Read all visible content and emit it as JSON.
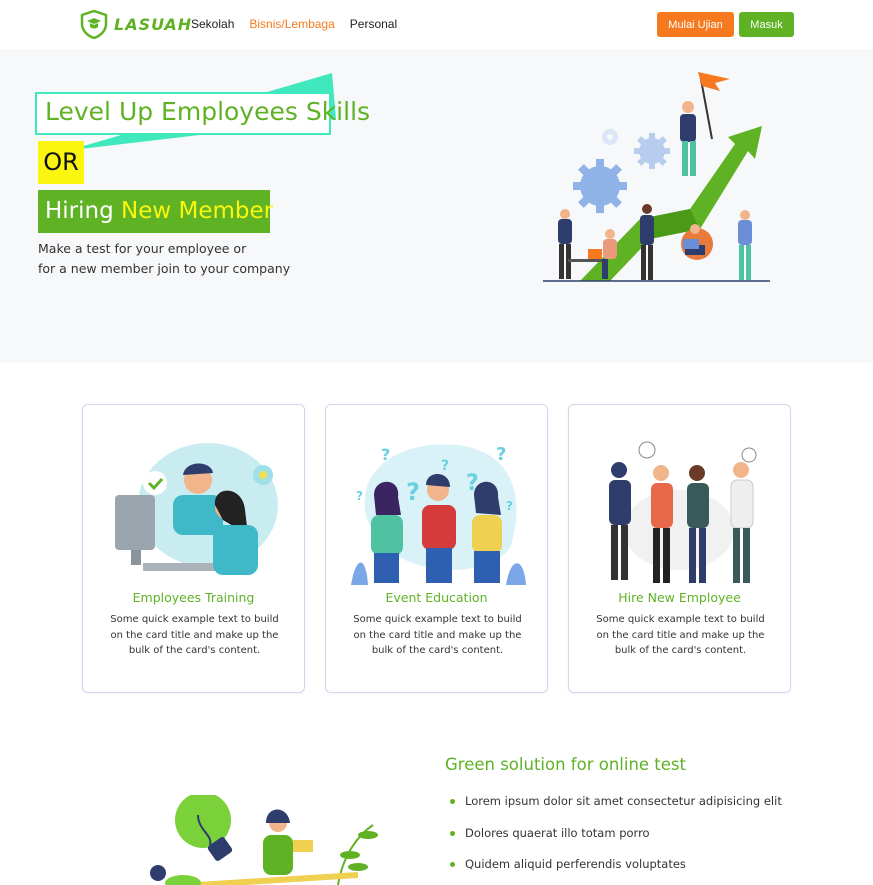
{
  "brand": {
    "name": "LASUAH",
    "color": "#5fb224"
  },
  "nav": {
    "links": [
      "Sekolah",
      "Bisnis/Lembaga",
      "Personal"
    ],
    "active_index": 1,
    "exam_button": "Mulai Ujian",
    "login_button": "Masuk"
  },
  "hero": {
    "title": "Level Up Employees Skills",
    "or_label": "OR",
    "hiring_prefix": "Hiring",
    "hiring_highlight": "New Member",
    "desc_line1": "Make a test for your employee or",
    "desc_line2": "for a new member join to your company"
  },
  "cards": [
    {
      "title": "Employees Training",
      "text": "Some quick example text to build on the card title and make up the bulk of the card's content."
    },
    {
      "title": "Event Education",
      "text": "Some quick example text to build on the card title and make up the bulk of the card's content."
    },
    {
      "title": "Hire New Employee",
      "text": "Some quick example text to build on the card title and make up the bulk of the card's content."
    }
  ],
  "solution": {
    "title": "Green solution for online test",
    "items": [
      "Lorem ipsum dolor sit amet consectetur adipisicing elit",
      "Dolores quaerat illo totam porro",
      "Quidem aliquid perferendis voluptates"
    ]
  },
  "colors": {
    "primary": "#5fb224",
    "accent": "#f7791f",
    "highlight": "#faf60f",
    "teal": "#3fe8bd"
  }
}
